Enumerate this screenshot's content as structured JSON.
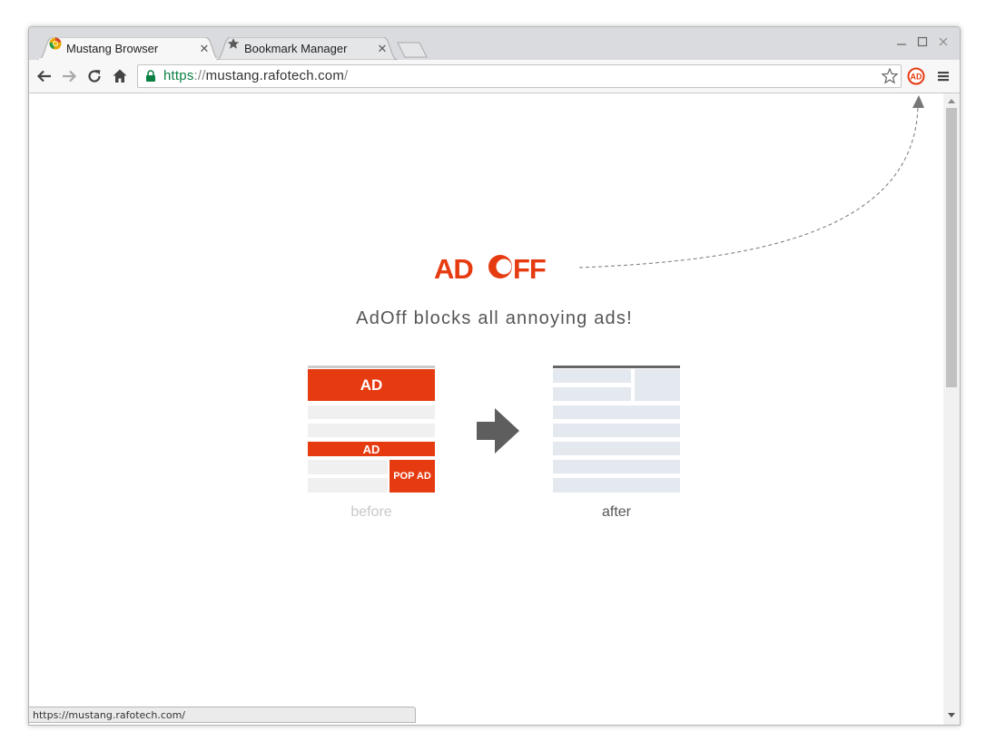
{
  "tabs": [
    {
      "title": "Mustang Browser",
      "icon": "mustang-browser-icon",
      "active": true
    },
    {
      "title": "Bookmark Manager",
      "icon": "star-icon",
      "active": false
    }
  ],
  "omnibox": {
    "scheme": "https",
    "sep": "://",
    "host": "mustang.rafotech.com",
    "path": "/"
  },
  "extension": {
    "label": "AD",
    "icon": "adoff-extension-icon"
  },
  "page": {
    "logo": {
      "left": "AD",
      "right": "FF"
    },
    "tagline": "AdOff blocks all annoying ads!",
    "before": {
      "ad_top": "AD",
      "ad_mid": "AD",
      "pop_ad": "POP AD",
      "caption": "before"
    },
    "after": {
      "caption": "after"
    }
  },
  "status_url": "https://mustang.rafotech.com/",
  "colors": {
    "brand": "#e63b11",
    "placeholder": "#e4e9f0",
    "gray_row": "#f0f0f0",
    "https": "#0b8043"
  }
}
